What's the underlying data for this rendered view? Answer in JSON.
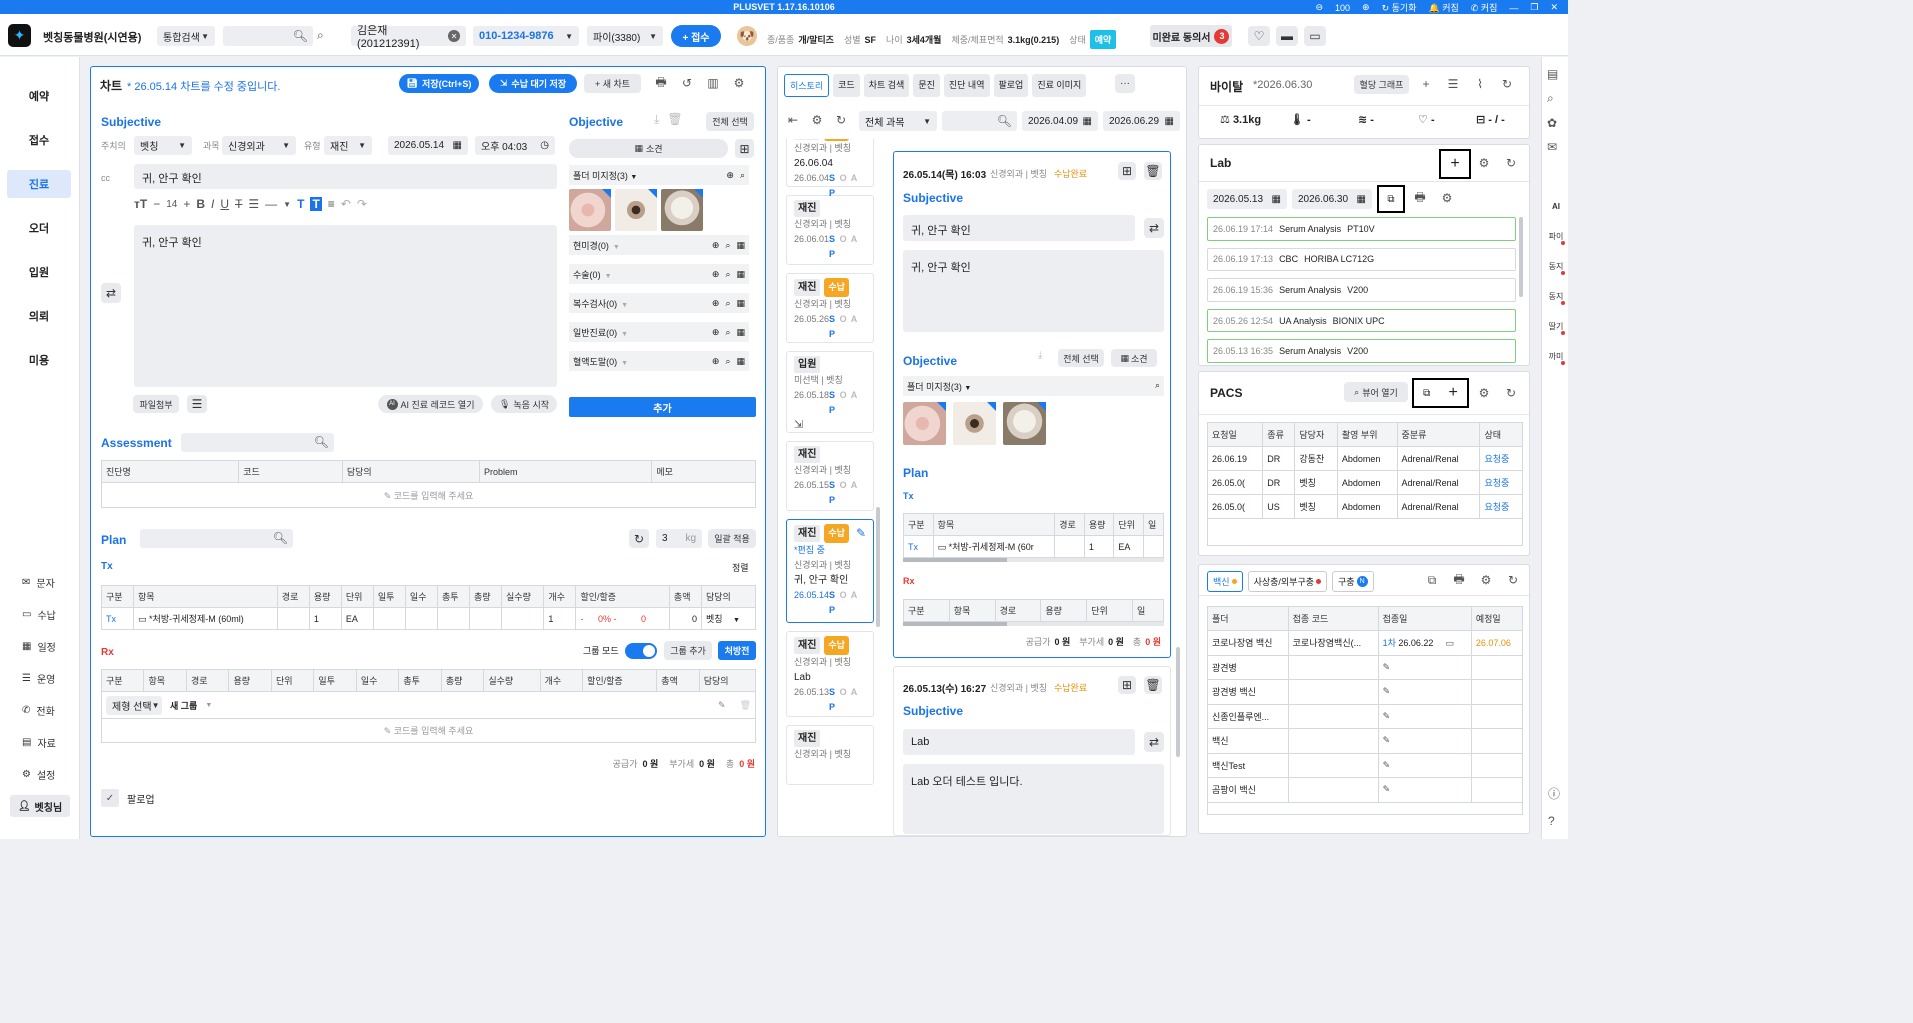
{
  "title_bar": {
    "title": "PLUSVET 1.17.16.10106",
    "zoom": "100",
    "links": [
      "동기화",
      "커짐",
      "커짐"
    ]
  },
  "header": {
    "hospital": "벳칭동물병원(시연용)",
    "search_scope": "통합검색",
    "patient_name": "김은재(201212391)",
    "phone": "010-1234-9876",
    "pet": "파이(3380)",
    "reception_button": "+ 접수",
    "breed_label": "종/품종",
    "breed": "개/말티즈",
    "sex_label": "성별",
    "sex": "SF",
    "age_label": "나이",
    "age": "3세4개월",
    "weight_label": "체중/체표면적",
    "weight": "3.1kg(0.215)",
    "status_label": "상태",
    "status": "예약",
    "unsigned_label": "미완료 동의서",
    "unsigned_count": "3"
  },
  "left_nav": {
    "main": [
      "예약",
      "접수",
      "진료",
      "오더",
      "입원",
      "의뢰",
      "미용"
    ],
    "active_index": 2,
    "bottom": [
      "문자",
      "수납",
      "일정",
      "운영",
      "전화",
      "자료",
      "설정"
    ],
    "user": "벳칭님"
  },
  "chart": {
    "title": "차트",
    "notice": "* 26.05.14 차트를 수정 중입니다.",
    "save_btn": "저장(Ctrl+S)",
    "wait_btn": "수납 대기 저장",
    "new_btn": "+ 새 차트",
    "subjective": {
      "title": "Subjective",
      "doctor_label": "주치의",
      "doctor": "벳칭",
      "dept_label": "과목",
      "dept": "신경외과",
      "type_label": "유형",
      "type": "재진",
      "date": "2026.05.14",
      "time": "오후 04:03",
      "cc_label": "cc",
      "cc": "귀, 안구 확인",
      "font_size": "14",
      "body": "귀, 안구 확인",
      "attach": "파일첨부",
      "ai_btn": "AI 진료 레코드 열기",
      "rec_btn": "녹음 시작"
    },
    "objective": {
      "title": "Objective",
      "select_all": "전체 선택",
      "findings": "소견",
      "unassigned": "폴더 미지정(3)",
      "folders": [
        "현미경(0)",
        "수술(0)",
        "복수검사(0)",
        "일반진료(0)",
        "혈액도말(0)"
      ],
      "add_btn": "추가"
    },
    "assessment": {
      "title": "Assessment",
      "cols": [
        "진단명",
        "코드",
        "담당의",
        "Problem",
        "메모"
      ],
      "empty": "코드를 입력해 주세요"
    },
    "plan": {
      "title": "Plan",
      "kg_value": "3",
      "kg_unit": "kg",
      "apply_btn": "일괄 적용",
      "tx_label": "Tx",
      "sort": "정렬",
      "tx_cols": [
        "구분",
        "항목",
        "경로",
        "용량",
        "단위",
        "일투",
        "일수",
        "총투",
        "총량",
        "실수량",
        "개수",
        "할인/할증",
        "총액",
        "담당의"
      ],
      "tx_row": {
        "kind": "Tx",
        "item": "*처방-귀세정제-M (60ml)",
        "dose": "1",
        "unit": "EA",
        "count": "1",
        "disc_pct": "0%",
        "disc_amt": "0",
        "total": "0",
        "doctor": "벳칭"
      },
      "rx_label": "Rx",
      "group_mode": "그룹 모드",
      "group_add": "그룹 추가",
      "prescription": "처방전",
      "rx_cols": [
        "구분",
        "항목",
        "경로",
        "용량",
        "단위",
        "일투",
        "일수",
        "총투",
        "총량",
        "실수량",
        "개수",
        "할인/할증",
        "총액",
        "담당의"
      ],
      "form_select": "제형 선택",
      "new_group": "새 그룹",
      "empty": "코드를 입력해 주세요",
      "supply_label": "공급가",
      "supply": "0 원",
      "vat_label": "부가세",
      "vat": "0 원",
      "total_label": "총",
      "total": "0 원"
    },
    "followup": "팔로업"
  },
  "history": {
    "tabs": [
      "히스토리",
      "코드",
      "차트 검색",
      "문진",
      "진단 내역",
      "팔로업",
      "진료 이미지"
    ],
    "filter": "전체 과목",
    "date_from": "2026.04.09",
    "date_to": "2026.06.29",
    "cards": [
      {
        "type": "재진",
        "paid": "수납",
        "dept": "신경외과 | 벳칭",
        "text": "26.06.04",
        "date": "26.06.04"
      },
      {
        "type": "재진",
        "paid": "",
        "dept": "신경외과 | 벳칭",
        "text": "",
        "date": "26.06.01"
      },
      {
        "type": "재진",
        "paid": "수납",
        "dept": "신경외과 | 벳칭",
        "text": "",
        "date": "26.05.26"
      },
      {
        "type": "입원",
        "paid": "",
        "dept": "미선택 | 벳칭",
        "text": "",
        "date": "26.05.18"
      },
      {
        "type": "재진",
        "paid": "",
        "dept": "신경외과 | 벳칭",
        "text": "",
        "date": "26.05.15"
      },
      {
        "type": "재진",
        "paid": "수납",
        "dept": "신경외과 | 벳칭",
        "text": "귀, 안구 확인",
        "date": "26.05.14",
        "editing": "*편집 중"
      },
      {
        "type": "재진",
        "paid": "수납",
        "dept": "신경외과 | 벳칭",
        "text": "Lab",
        "date": "26.05.13"
      },
      {
        "type": "재진",
        "paid": "",
        "dept": "신경외과 | 벳칭",
        "text": "",
        "date": ""
      }
    ],
    "detail1": {
      "datetime": "26.05.14(목) 16:03",
      "dept": "신경외과 | 벳칭",
      "status": "수납완료",
      "subj_title": "Subjective",
      "cc": "귀, 안구 확인",
      "body": "귀, 안구 확인",
      "obj_title": "Objective",
      "select_all": "전체 선택",
      "findings": "소견",
      "unassigned": "폴더 미지정(3)",
      "plan_title": "Plan",
      "tx": "Tx",
      "tx_cols": [
        "구분",
        "항목",
        "경로",
        "용량",
        "단위",
        "일"
      ],
      "tx_row": {
        "kind": "Tx",
        "item": "*처방-귀세정제-M (60r",
        "dose": "1",
        "unit": "EA"
      },
      "rx": "Rx",
      "rx_cols": [
        "구분",
        "항목",
        "경로",
        "용량",
        "단위",
        "일"
      ],
      "supply_label": "공급가",
      "supply": "0 원",
      "vat_label": "부가세",
      "vat": "0 원",
      "total_label": "총",
      "total": "0 원"
    },
    "detail2": {
      "datetime": "26.05.13(수) 16:27",
      "dept": "신경외과 | 벳칭",
      "status": "수납완료",
      "subj_title": "Subjective",
      "cc": "Lab",
      "body": "Lab 오더 테스트 입니다."
    }
  },
  "vital": {
    "title": "바이탈",
    "date": "*2026.06.30",
    "graph_btn": "혈당 그래프",
    "weight": "3.1kg",
    "temp": "-",
    "resp": "-",
    "hr": "-",
    "bp": "- / -"
  },
  "lab": {
    "title": "Lab",
    "date_from": "2026.05.13",
    "date_to": "2026.06.30",
    "items": [
      {
        "dt": "26.06.19 17:14",
        "name": "Serum Analysis",
        "device": "PT10V",
        "green": true
      },
      {
        "dt": "26.06.19 17:13",
        "name": "CBC",
        "device": "HORIBA LC712G",
        "green": false
      },
      {
        "dt": "26.06.19 15:36",
        "name": "Serum Analysis",
        "device": "V200",
        "green": false
      },
      {
        "dt": "26.05.26 12:54",
        "name": "UA Analysis",
        "device": "BIONIX UPC",
        "green": true
      },
      {
        "dt": "26.05.13 16:35",
        "name": "Serum Analysis",
        "device": "V200",
        "green": true
      }
    ]
  },
  "pacs": {
    "title": "PACS",
    "viewer_btn": "뷰어 열기",
    "cols": [
      "요청일",
      "종류",
      "담당자",
      "촬영 부위",
      "중분류",
      "상태"
    ],
    "rows": [
      [
        "26.06.19",
        "DR",
        "강동찬",
        "Abdomen",
        "Adrenal/Renal",
        "요청중"
      ],
      [
        "26.05.0(",
        "DR",
        "벳칭",
        "Abdomen",
        "Adrenal/Renal",
        "요청중"
      ],
      [
        "26.05.0(",
        "US",
        "벳칭",
        "Abdomen",
        "Adrenal/Renal",
        "요청중"
      ]
    ]
  },
  "vaccine": {
    "tabs": [
      "백신",
      "사상충/외부구충",
      "구충"
    ],
    "cols": [
      "폴더",
      "접종 코드",
      "접종일",
      "예정일"
    ],
    "rows": [
      {
        "folder": "코로나장염 백신",
        "code": "코로나장염백신(...",
        "round": "1차",
        "date": "26.06.22",
        "due": "26.07.06"
      },
      {
        "folder": "광견병",
        "code": "",
        "round": "",
        "date": "",
        "due": ""
      },
      {
        "folder": "광견병 백신",
        "code": "",
        "round": "",
        "date": "",
        "due": ""
      },
      {
        "folder": "신종인플루엔...",
        "code": "",
        "round": "",
        "date": "",
        "due": ""
      },
      {
        "folder": "백신",
        "code": "",
        "round": "",
        "date": "",
        "due": ""
      },
      {
        "folder": "백신Test",
        "code": "",
        "round": "",
        "date": "",
        "due": ""
      },
      {
        "folder": "곰팡이 백신",
        "code": "",
        "round": "",
        "date": "",
        "due": ""
      }
    ]
  },
  "right_rail": [
    "AI",
    "파이",
    "동지",
    "동지",
    "딸기",
    "까미"
  ]
}
